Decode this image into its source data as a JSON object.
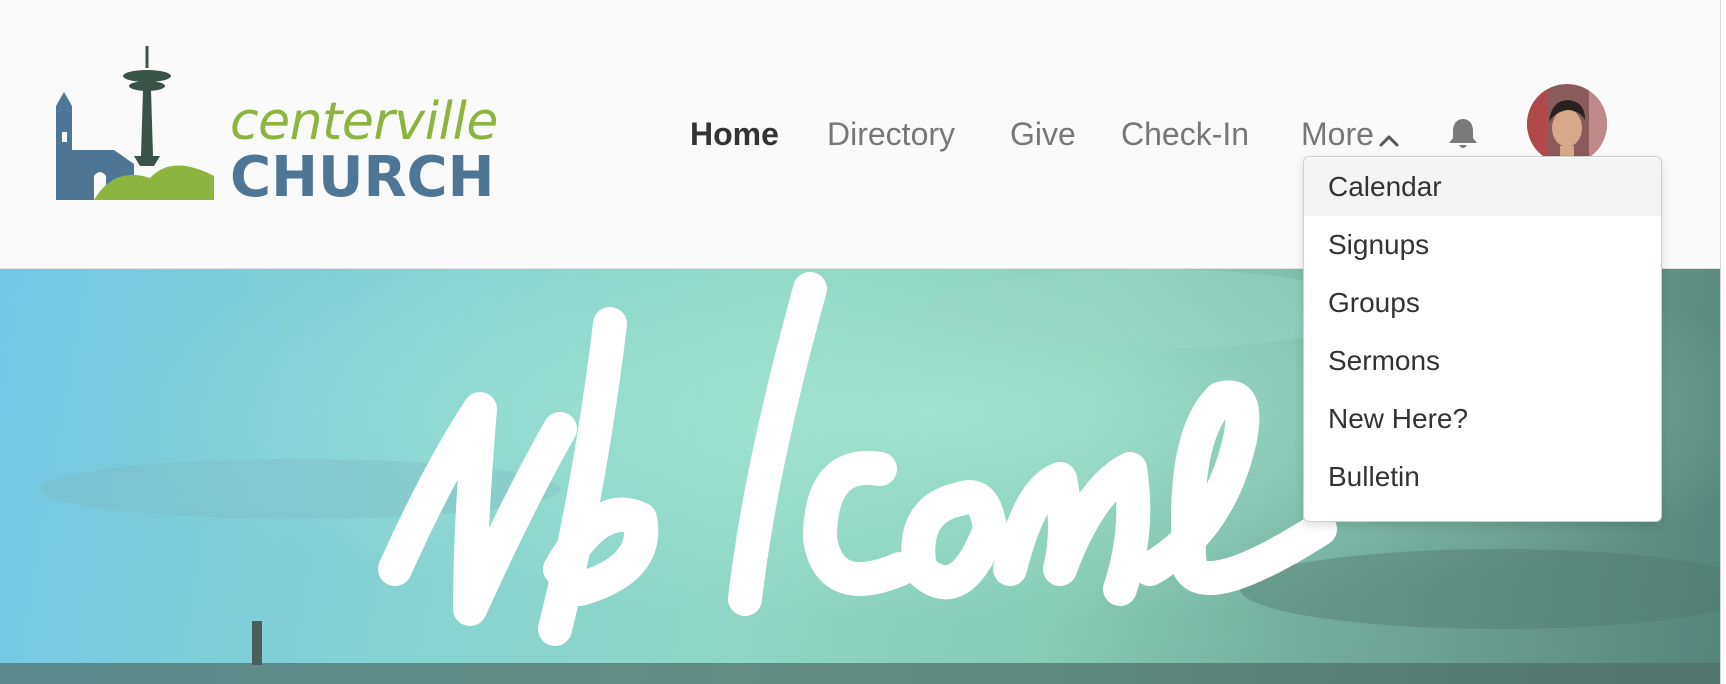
{
  "logo": {
    "line1": "centerville",
    "line2": "CHURCH"
  },
  "nav": {
    "items": [
      {
        "label": "Home",
        "active": true
      },
      {
        "label": "Directory"
      },
      {
        "label": "Give"
      },
      {
        "label": "Check-In"
      },
      {
        "label": "More"
      }
    ]
  },
  "dropdown": {
    "items": [
      "Calendar",
      "Signups",
      "Groups",
      "Sermons",
      "New Here?",
      "Bulletin"
    ]
  },
  "colors": {
    "logo_green": "#8db43e",
    "logo_blue": "#4e7697",
    "nav_active": "#333333",
    "nav_inactive": "#777777"
  },
  "icons": [
    "bell-icon",
    "chevron-up-icon",
    "user-avatar"
  ]
}
